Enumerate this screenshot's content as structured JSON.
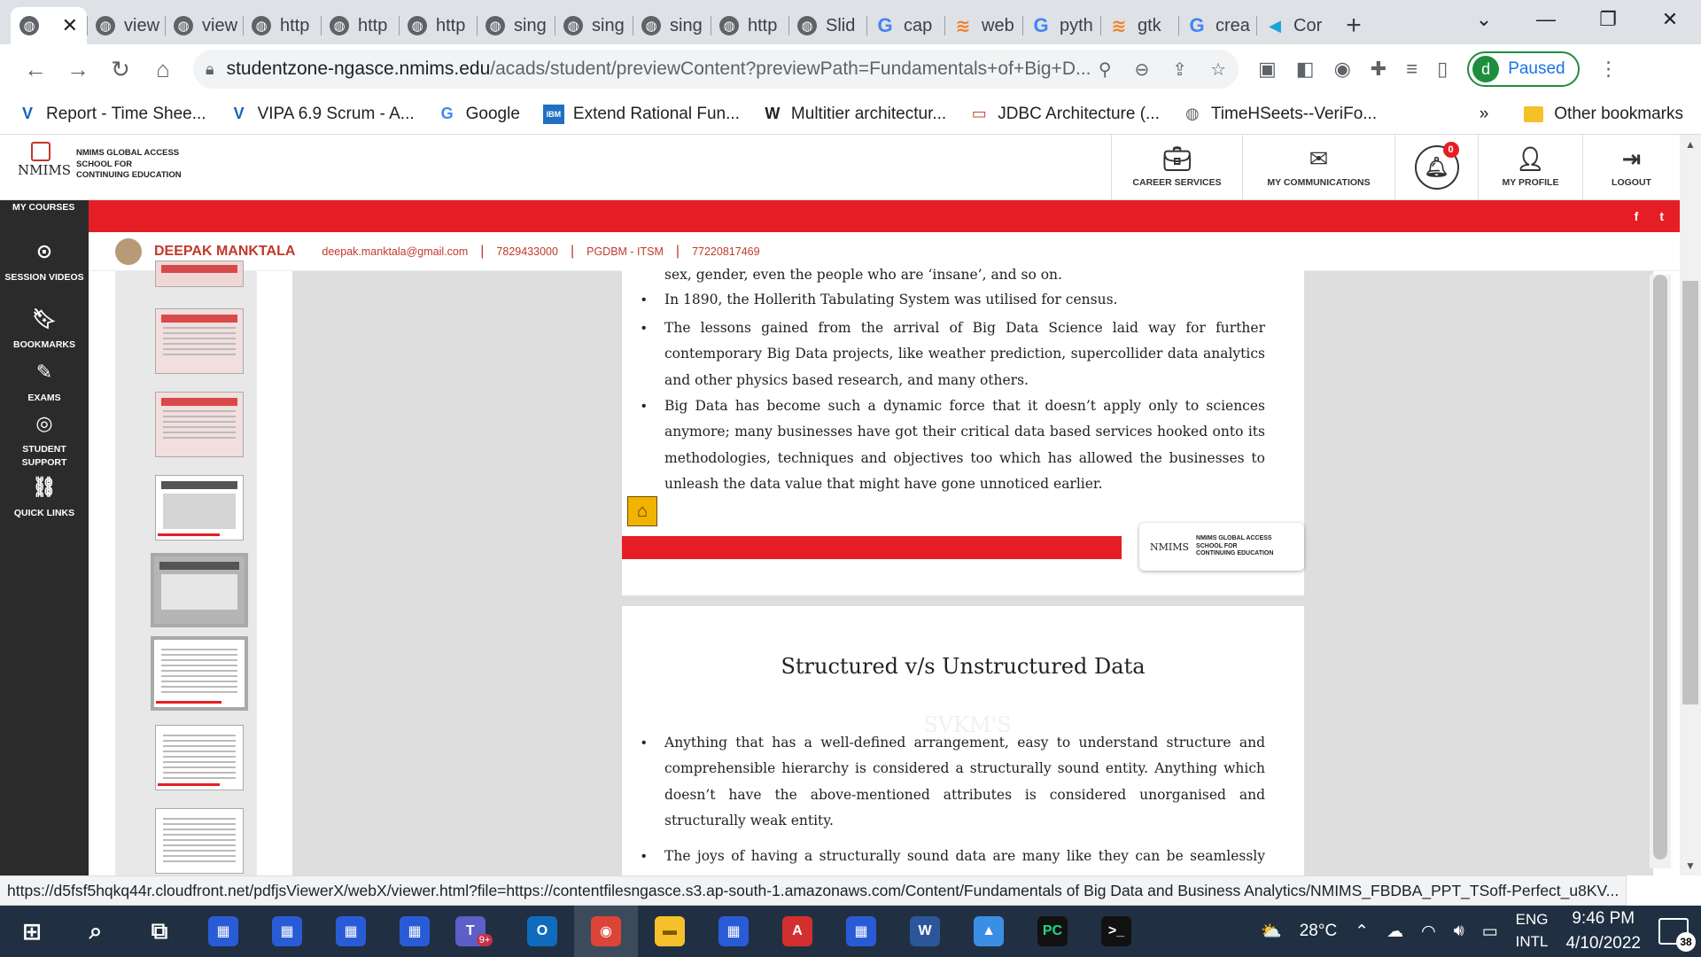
{
  "browser": {
    "tabs": [
      {
        "label": "",
        "icon": "globe-icon",
        "active": true
      },
      {
        "label": "view",
        "icon": "globe-icon"
      },
      {
        "label": "view",
        "icon": "globe-icon"
      },
      {
        "label": "http",
        "icon": "globe-icon"
      },
      {
        "label": "http",
        "icon": "globe-icon"
      },
      {
        "label": "http",
        "icon": "globe-icon"
      },
      {
        "label": "sing",
        "icon": "globe-icon"
      },
      {
        "label": "sing",
        "icon": "globe-icon"
      },
      {
        "label": "sing",
        "icon": "globe-icon"
      },
      {
        "label": "http",
        "icon": "globe-icon"
      },
      {
        "label": "Slid",
        "icon": "globe-icon"
      },
      {
        "label": "cap",
        "icon": "google-icon"
      },
      {
        "label": "web",
        "icon": "stackoverflow-icon"
      },
      {
        "label": "pyth",
        "icon": "google-icon"
      },
      {
        "label": "gtk",
        "icon": "stackoverflow-icon"
      },
      {
        "label": "crea",
        "icon": "google-icon"
      },
      {
        "label": "Cor",
        "icon": "coursera-icon"
      }
    ],
    "address": {
      "host": "studentzone-ngasce.nmims.edu",
      "path": "/acads/student/previewContent?previewPath=Fundamentals+of+Big+D..."
    },
    "profile": {
      "initial": "d",
      "label": "Paused"
    },
    "bookmarks": [
      {
        "label": "Report - Time Shee...",
        "icon": "v-icon"
      },
      {
        "label": "VIPA 6.9 Scrum - A...",
        "icon": "v-icon"
      },
      {
        "label": "Google",
        "icon": "google-icon"
      },
      {
        "label": "Extend Rational Fun...",
        "icon": "ibm-icon"
      },
      {
        "label": "Multitier architectur...",
        "icon": "wikipedia-icon"
      },
      {
        "label": "JDBC Architecture (...",
        "icon": "oracle-icon"
      },
      {
        "label": "TimeHSeets--VeriFo...",
        "icon": "globe-icon"
      }
    ],
    "bookmarks_more": "»",
    "other_bookmarks": "Other bookmarks",
    "status_url": "https://d5fsf5hqkq44r.cloudfront.net/pdfjsViewerX/webX/viewer.html?file=https://contentfilesngasce.s3.ap-south-1.amazonaws.com/Content/Fundamentals of Big Data and Business Analytics/NMIMS_FBDBA_PPT_TSoff-Perfect_u8KV..."
  },
  "site": {
    "logo_mark": "NMIMS",
    "logo_lines": [
      "NMIMS GLOBAL ACCESS",
      "SCHOOL FOR",
      "CONTINUING EDUCATION"
    ],
    "nav": [
      {
        "label": "CAREER SERVICES",
        "icon": "briefcase-icon"
      },
      {
        "label": "MY COMMUNICATIONS",
        "icon": "envelope-icon"
      },
      {
        "label": "",
        "icon": "bell-icon",
        "badge": "0"
      },
      {
        "label": "MY PROFILE",
        "icon": "user-icon"
      },
      {
        "label": "LOGOUT",
        "icon": "logout-icon"
      }
    ],
    "social": [
      "f",
      "t"
    ],
    "user": {
      "name": "DEEPAK MANKTALA",
      "email": "deepak.manktala@gmail.com",
      "phone": "7829433000",
      "program": "PGDBM - ITSM",
      "id": "77220817469"
    },
    "sidebar": {
      "heading": "MY COURSES",
      "items": [
        {
          "label": "SESSION VIDEOS",
          "icon": "play-circle-icon"
        },
        {
          "label": "BOOKMARKS",
          "icon": "bookmark-icon"
        },
        {
          "label": "EXAMS",
          "icon": "exam-icon"
        },
        {
          "label": "STUDENT SUPPORT",
          "icon": "lifebuoy-icon"
        },
        {
          "label": "QUICK LINKS",
          "icon": "link-icon"
        }
      ]
    }
  },
  "slides": {
    "slide1": {
      "bullets": [
        "sex, gender, even the people who are ‘insane’, and so on.",
        "In 1890, the Hollerith Tabulating System was utilised for census.",
        "The lessons gained from the arrival of Big Data Science laid way for further contemporary Big Data projects, like weather prediction, supercollider data analytics and other physics based research, and many others.",
        "Big Data has become such a dynamic force that it doesn’t apply only to sciences anymore; many businesses have got their critical data based services hooked onto its methodologies, techniques and objectives too which has allowed the businesses to unleash the data value that might have gone unnoticed earlier."
      ],
      "logo_mark": "NMIMS",
      "logo_lines": [
        "NMIMS GLOBAL ACCESS",
        "SCHOOL FOR",
        "CONTINUING EDUCATION"
      ]
    },
    "slide2": {
      "title": "Structured v/s Unstructured Data",
      "watermark": "SVKM'S",
      "bullets": [
        "Anything that has a well-defined arrangement, easy to understand structure and comprehensible hierarchy is considered a structurally sound entity. Anything which doesn’t have the above-mentioned attributes is considered unorganised and structurally weak entity.",
        "The joys of having a structurally sound data are many like they can be seamlessly added in a relational database and are easily searchable by simplest"
      ]
    }
  },
  "taskbar": {
    "apps": [
      "start-icon",
      "search-icon",
      "task-view-icon",
      "app-icon",
      "app-icon",
      "app-icon",
      "app-icon",
      "teams-icon",
      "outlook-icon",
      "chrome-icon",
      "explorer-icon",
      "app-icon",
      "acrobat-icon",
      "app-icon",
      "word-icon",
      "photos-icon",
      "pycharm-icon",
      "terminal-icon"
    ],
    "teams_badge": "9+",
    "weather": "28°C",
    "lang_top": "ENG",
    "lang_bottom": "INTL",
    "time": "9:46 PM",
    "date": "4/10/2022",
    "notifications": "38"
  }
}
